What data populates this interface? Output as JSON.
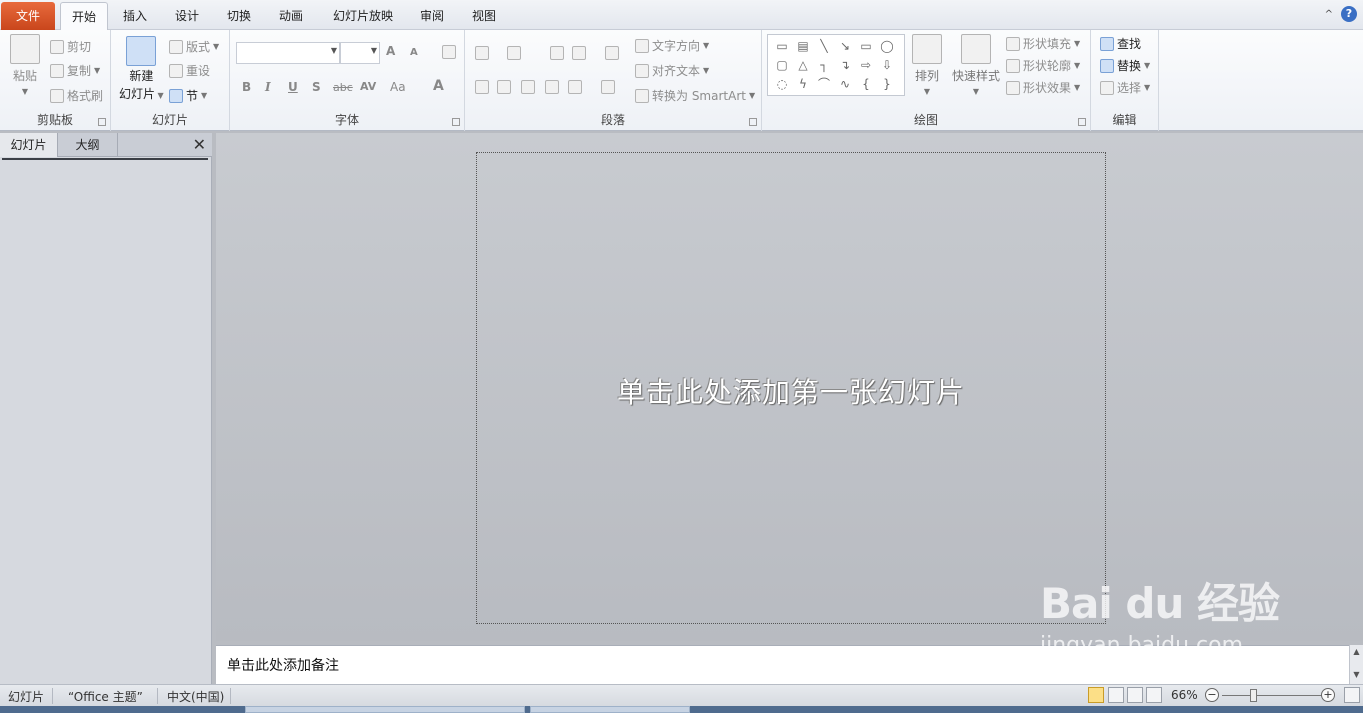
{
  "tabs": {
    "file": "文件",
    "items": [
      "开始",
      "插入",
      "设计",
      "切换",
      "动画",
      "幻灯片放映",
      "审阅",
      "视图"
    ],
    "help_glyph": "?",
    "minimize_glyph": "^"
  },
  "ribbon": {
    "clipboard": {
      "label": "剪贴板",
      "paste": "粘贴",
      "cut": "剪切",
      "copy": "复制",
      "format_painter": "格式刷"
    },
    "slides": {
      "label": "幻灯片",
      "new_slide_line1": "新建",
      "new_slide_line2": "幻灯片",
      "layout": "版式",
      "reset": "重设",
      "section": "节"
    },
    "font": {
      "label": "字体",
      "bold": "B",
      "italic": "I",
      "underline": "U",
      "shadow": "S",
      "strike": "abc",
      "spacing": "AV",
      "case": "Aa",
      "color": "A",
      "grow": "A",
      "shrink": "A"
    },
    "paragraph": {
      "label": "段落",
      "text_direction": "文字方向",
      "align_text": "对齐文本",
      "smartart": "转换为 SmartArt"
    },
    "drawing": {
      "label": "绘图",
      "arrange": "排列",
      "quick_styles": "快速样式",
      "shape_fill": "形状填充",
      "shape_outline": "形状轮廓",
      "shape_effects": "形状效果"
    },
    "editing": {
      "label": "编辑",
      "find": "查找",
      "replace": "替换",
      "select": "选择"
    }
  },
  "left_pane": {
    "tab_slides": "幻灯片",
    "tab_outline": "大纲",
    "close": "✕"
  },
  "slide": {
    "placeholder": "单击此处添加第一张幻灯片"
  },
  "notes": {
    "placeholder": "单击此处添加备注"
  },
  "status": {
    "view": "幻灯片",
    "theme": "“Office 主题”",
    "language": "中文(中国)",
    "zoom": "66%",
    "zoom_out": "−",
    "zoom_in": "+"
  },
  "watermark": {
    "logo": "Bai du 经验",
    "url": "jingyan.baidu.com"
  }
}
